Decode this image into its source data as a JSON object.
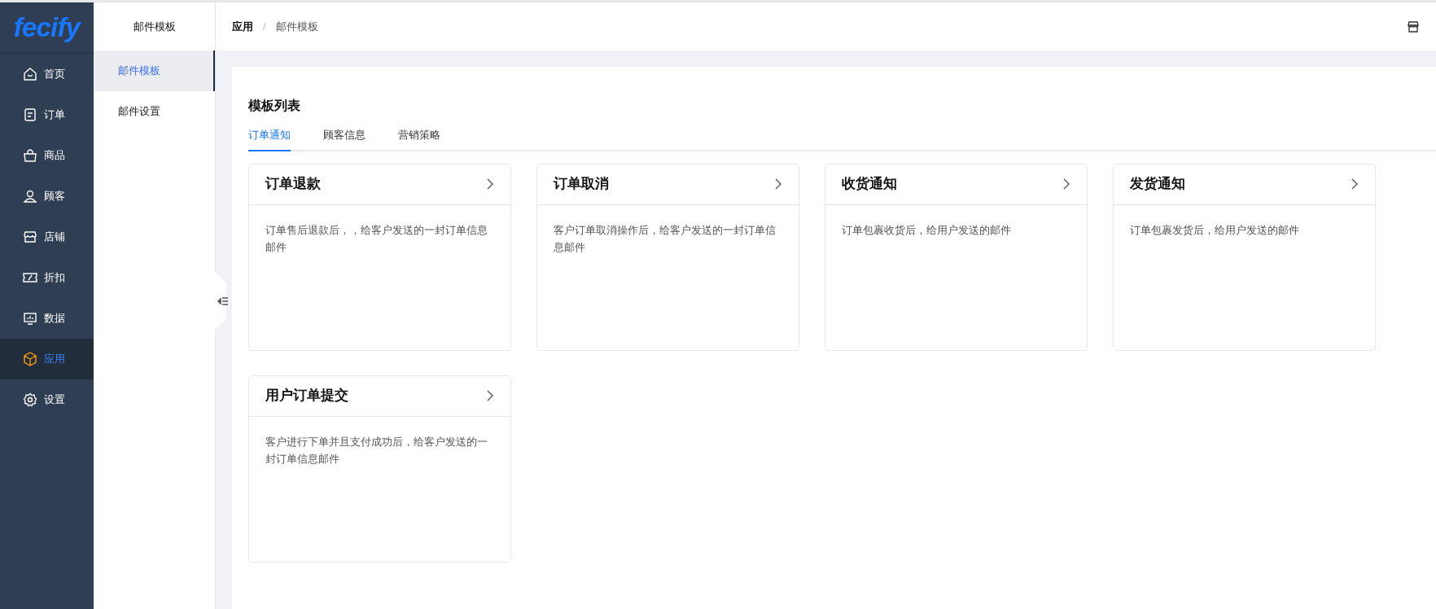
{
  "logo": {
    "text": "fecify"
  },
  "nav": [
    {
      "label": "首页",
      "selected": false
    },
    {
      "label": "订单",
      "selected": false
    },
    {
      "label": "商品",
      "selected": false
    },
    {
      "label": "顾客",
      "selected": false
    },
    {
      "label": "店铺",
      "selected": false
    },
    {
      "label": "折扣",
      "selected": false
    },
    {
      "label": "数据",
      "selected": false
    },
    {
      "label": "应用",
      "selected": true
    },
    {
      "label": "设置",
      "selected": false
    }
  ],
  "subnav": {
    "title": "邮件模板",
    "items": [
      {
        "label": "邮件模板",
        "selected": true
      },
      {
        "label": "邮件设置",
        "selected": false
      }
    ]
  },
  "breadcrumb": [
    "应用",
    "邮件模板"
  ],
  "breadcrumb_separator": "/",
  "section_title": "模板列表",
  "tabs": [
    {
      "label": "订单通知",
      "selected": true
    },
    {
      "label": "顾客信息",
      "selected": false
    },
    {
      "label": "营销策略",
      "selected": false
    }
  ],
  "cards": [
    {
      "title": "订单退款",
      "description": "订单售后退款后，，给客户发送的一封订单信息邮件"
    },
    {
      "title": "订单取消",
      "description": "客户订单取消操作后，给客户发送的一封订单信息邮件"
    },
    {
      "title": "收货通知",
      "description": "订单包裹收货后，给用户发送的邮件"
    },
    {
      "title": "发货通知",
      "description": "订单包裹发货后，给用户发送的邮件"
    },
    {
      "title": "用户订单提交",
      "description": "客户进行下单并且支付成功后，给客户发送的一封订单信息邮件"
    }
  ]
}
